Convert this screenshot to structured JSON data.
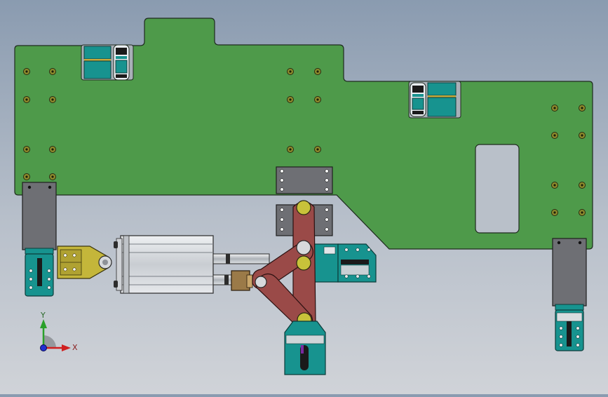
{
  "viewport": {
    "view": "top",
    "colors": {
      "plate": "#4e9a4a",
      "plate_edge": "#1e2a1e",
      "teal": "#17938f",
      "dark_grey": "#6e6f74",
      "link_red": "#9a4a48",
      "pin_yellow": "#c8c23a",
      "clevis_yellow": "#c4b63a",
      "cylinder": "#d5d8dc",
      "block_brown": "#9b7a48"
    }
  },
  "triad": {
    "y_label": "Y",
    "x_label": "X",
    "icons": [
      "y-axis-arrow-icon",
      "x-axis-arrow-icon",
      "z-axis-dot-icon"
    ]
  }
}
